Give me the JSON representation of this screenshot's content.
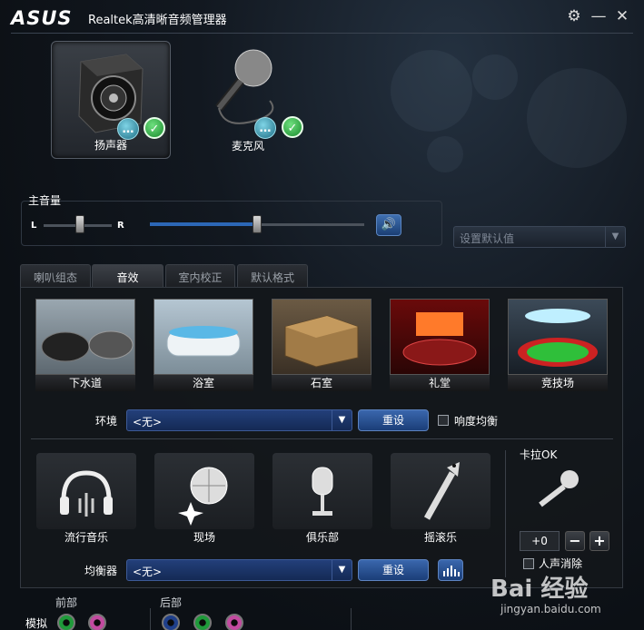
{
  "titlebar": {
    "logo": "ASUS",
    "title": "Realtek高清晰音频管理器"
  },
  "devices": [
    {
      "label": "扬声器",
      "active": true
    },
    {
      "label": "麦克风",
      "active": false
    }
  ],
  "volume": {
    "title": "主音量",
    "left": "L",
    "right": "R",
    "balance_fraction": 0.5,
    "level_fraction": 0.5
  },
  "default_format_dropdown": {
    "placeholder": "设置默认值"
  },
  "tabs": [
    "喇叭组态",
    "音效",
    "室内校正",
    "默认格式"
  ],
  "active_tab": "音效",
  "environments": [
    "下水道",
    "浴室",
    "石室",
    "礼堂",
    "竞技场"
  ],
  "environment_row": {
    "label": "环境",
    "value": "<无>",
    "reset": "重设",
    "loudness": "响度均衡"
  },
  "genres": [
    "流行音乐",
    "现场",
    "俱乐部",
    "摇滚乐"
  ],
  "karaoke": {
    "title": "卡拉OK",
    "value": "+0",
    "minus": "−",
    "plus": "+",
    "vocal_cancel": "人声消除"
  },
  "equalizer_row": {
    "label": "均衡器",
    "value": "<无>",
    "reset": "重设"
  },
  "connectors": {
    "front": "前部",
    "rear": "后部",
    "analog": "模拟"
  },
  "watermark": {
    "text": "Bai 经验",
    "url": "jingyan.baidu.com"
  },
  "colors": {
    "accent": "#2c67b6",
    "jack_green": "#1f9a3a",
    "jack_pink": "#c34aa0",
    "jack_blue": "#1f3f8a"
  }
}
